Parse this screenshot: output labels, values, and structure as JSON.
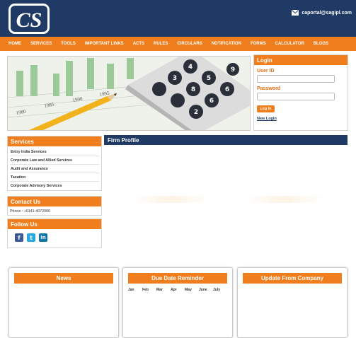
{
  "header": {
    "logo_text": "CS",
    "email": "caportal@sagipl.com"
  },
  "nav": {
    "items": [
      "HOME",
      "SERVICES",
      "TOOLS",
      "IMPORTANT LINKS",
      "ACTS",
      "RULES",
      "CIRCULARS",
      "NOTIFICATION",
      "FORMS",
      "CALCULATOR",
      "BLOGS"
    ]
  },
  "banner": {
    "ledger_years": [
      "1980",
      "1985",
      "1990",
      "1995"
    ],
    "calc_keys": [
      "4",
      "5",
      "6",
      "9",
      "3",
      "8",
      "6",
      "2"
    ]
  },
  "login": {
    "title": "Login",
    "userid_label": "User ID",
    "password_label": "Password",
    "button_label": "Log In",
    "new_login": "New Login"
  },
  "services": {
    "title": "Services",
    "items": [
      "Entry India Services",
      "Corporate Law and Allied Services",
      "Audit and Assurance",
      "Taxation",
      "Corporate Advisory Services"
    ]
  },
  "contact": {
    "title": "Contact Us",
    "phone": "Phone : +0141-4072000"
  },
  "follow": {
    "title": "Follow Us",
    "icons": [
      "facebook-icon",
      "twitter-icon",
      "linkedin-icon"
    ]
  },
  "firm": {
    "title": "Firm Profile"
  },
  "bottom": {
    "news_title": "News",
    "due_title": "Due Date Reminder",
    "update_title": "Update From Company",
    "months": [
      "Jan",
      "Feb",
      "Mar",
      "Apr",
      "May",
      "June",
      "July"
    ]
  },
  "colors": {
    "navy": "#1f3a64",
    "orange": "#f07e1d"
  }
}
